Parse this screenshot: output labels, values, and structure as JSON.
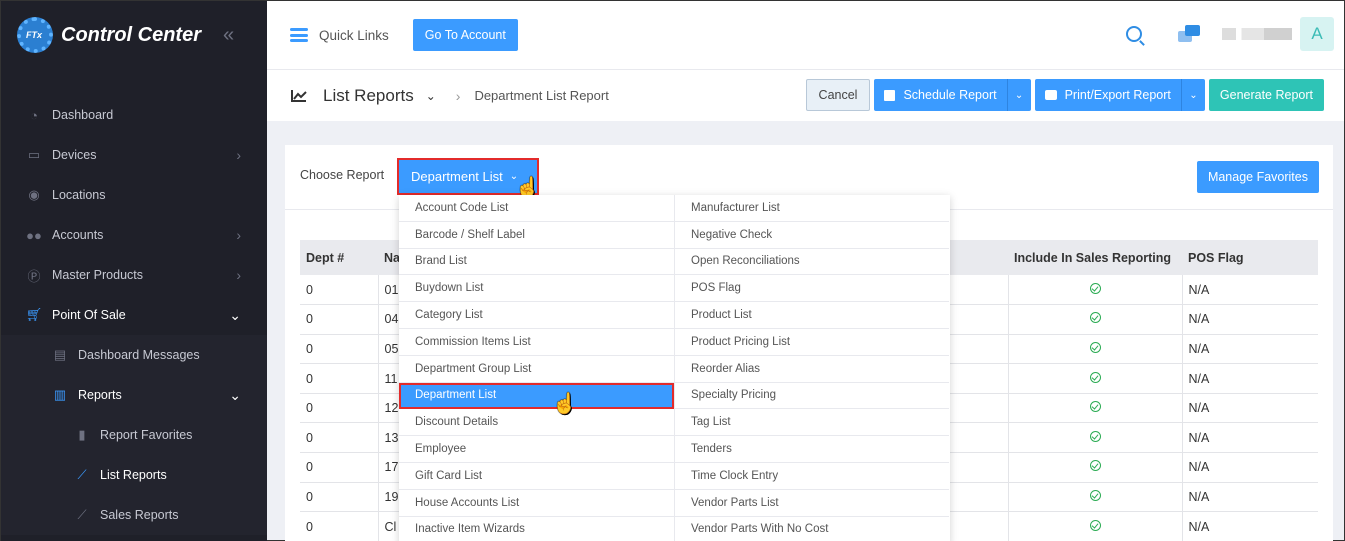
{
  "brand": {
    "logo_text": "FTx",
    "title": "Control Center",
    "collapse_icon": "double-chevron-left-icon"
  },
  "sidebar": {
    "items": [
      {
        "label": "Dashboard",
        "icon": "dashboard-icon"
      },
      {
        "label": "Devices",
        "icon": "devices-icon",
        "chevron": "›"
      },
      {
        "label": "Locations",
        "icon": "location-pin-icon"
      },
      {
        "label": "Accounts",
        "icon": "users-icon",
        "chevron": "›"
      },
      {
        "label": "Master Products",
        "icon": "product-icon",
        "chevron": "›"
      },
      {
        "label": "Point Of Sale",
        "icon": "cart-icon",
        "chevron": "⌄"
      },
      {
        "label": "Dashboard Messages",
        "icon": "messages-icon"
      },
      {
        "label": "Reports",
        "icon": "bar-chart-icon",
        "chevron": "⌄"
      },
      {
        "label": "Report Favorites",
        "icon": "bookmark-icon"
      },
      {
        "label": "List Reports",
        "icon": "line-chart-icon"
      },
      {
        "label": "Sales Reports",
        "icon": "line-chart-icon"
      }
    ]
  },
  "topbar": {
    "quick_links": "Quick Links",
    "go_to_account": "Go To Account",
    "avatar_letter": "A"
  },
  "subheader": {
    "title": "List Reports",
    "breadcrumb": "Department List Report",
    "cancel": "Cancel",
    "schedule": "Schedule Report",
    "print_export": "Print/Export Report",
    "generate": "Generate Report"
  },
  "report": {
    "choose_label": "Choose Report",
    "selected": "Department List",
    "manage_favorites": "Manage Favorites"
  },
  "dropdown": {
    "col1": [
      "Account Code List",
      "Barcode / Shelf Label",
      "Brand List",
      "Buydown List",
      "Category List",
      "Commission Items List",
      "Department Group List",
      "Department List",
      "Discount Details",
      "Employee",
      "Gift Card List",
      "House Accounts List",
      "Inactive Item Wizards"
    ],
    "col2": [
      "Manufacturer List",
      "Negative Check",
      "Open Reconciliations",
      "POS Flag",
      "Product List",
      "Product Pricing List",
      "Reorder Alias",
      "Specialty Pricing",
      "Tag List",
      "Tenders",
      "Time Clock Entry",
      "Vendor Parts List",
      "Vendor Parts With No Cost"
    ],
    "selected_index": 7
  },
  "table": {
    "headers": [
      "Dept #",
      "Na",
      "Include In Sales Reporting",
      "POS Flag"
    ],
    "rows": [
      [
        "0",
        "01",
        "N/A"
      ],
      [
        "0",
        "04",
        "N/A"
      ],
      [
        "0",
        "05",
        "N/A"
      ],
      [
        "0",
        "11",
        "N/A"
      ],
      [
        "0",
        "12",
        "N/A"
      ],
      [
        "0",
        "13",
        "N/A"
      ],
      [
        "0",
        "17",
        "N/A"
      ],
      [
        "0",
        "19",
        "N/A"
      ],
      [
        "0",
        "Cl",
        "N/A"
      ]
    ]
  },
  "colors": {
    "sidebar": "#1f2029",
    "primary": "#3b9bff",
    "teal": "#2ec4b6",
    "highlight": "#e32b2b",
    "check": "#2bab53"
  }
}
